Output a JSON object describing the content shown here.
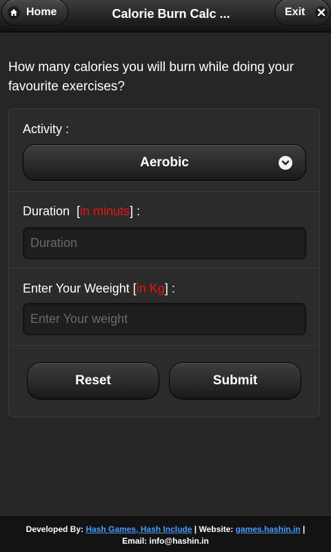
{
  "header": {
    "title": "Calorie Burn Calc ...",
    "home_label": "Home",
    "exit_label": "Exit",
    "home_icon": "home-icon",
    "exit_icon": "close-icon"
  },
  "intro_text": "How many calories you will burn while doing your favourite exercises?",
  "form": {
    "activity_label": "Activity :",
    "activity_value": "Aerobic",
    "duration_label": "Duration",
    "duration_unit": "in minuts",
    "duration_placeholder": "Duration",
    "weight_label": "Enter Your Weeight",
    "weight_unit": "in Kg",
    "weight_placeholder": "Enter Your weight",
    "reset_label": "Reset",
    "submit_label": "Submit"
  },
  "footer": {
    "developed_by_label": "Developed By:",
    "developer_link": "Hash Games, Hash Include",
    "website_label": "Website:",
    "website_link": "games.hashin.in",
    "email_text": "Email: info@hashin.in"
  },
  "colors": {
    "background": "#262626",
    "accent_red": "#ee1111",
    "link": "#4a9cff"
  }
}
